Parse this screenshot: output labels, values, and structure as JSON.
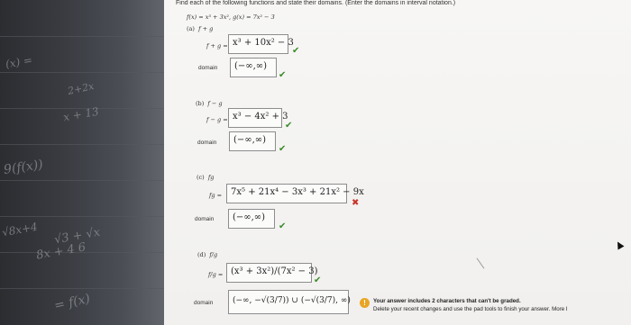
{
  "header": "Find each of the following functions and state their domains. (Enter the domains in interval notation.)",
  "given": "f(x) = x³ + 3x²,   g(x) = 7x² − 3",
  "parts": [
    {
      "label": "(a)",
      "operation": "f + g",
      "lhs": "f + g =",
      "answer": "x³ + 10x² − 3",
      "answer_status": "correct",
      "domain_label": "domain",
      "domain": "(−∞,∞)",
      "domain_status": "correct"
    },
    {
      "label": "(b)",
      "operation": "f − g",
      "lhs": "f − g =",
      "answer": "x³ − 4x² + 3",
      "answer_status": "correct",
      "domain_label": "domain",
      "domain": "(−∞,∞)",
      "domain_status": "correct"
    },
    {
      "label": "(c)",
      "operation": "fg",
      "lhs": "fg =",
      "answer": "7x⁵ + 21x⁴ − 3x³ + 21x² − 9x",
      "answer_status": "incorrect",
      "domain_label": "domain",
      "domain": "(−∞,∞)",
      "domain_status": "correct"
    },
    {
      "label": "(d)",
      "operation": "f/g",
      "lhs": "f/g =",
      "answer": "(x³ + 3x²)/(7x² − 3)",
      "answer_status": "correct",
      "domain_label": "domain",
      "domain": "(−∞, −√(3/7)) ∪ (−√(3/7), ∞)",
      "domain_status": "warning"
    }
  ],
  "warning": {
    "title": "Your answer includes 2 characters that can't be graded.",
    "body": "Delete your recent changes and use the pad tools to finish your answer. More I"
  },
  "marks": {
    "check": "✔",
    "cross": "✖",
    "warn": "!"
  },
  "colors": {
    "check": "#3a8a2a",
    "cross": "#c8332a",
    "warn": "#e8a524"
  },
  "notebook_scrawls": [
    "9(f(x))",
    "x + 13",
    "(x) =",
    "2+2x",
    "√3 + √x",
    "8x + 4 6",
    "= f(x)",
    "√8x+4"
  ]
}
